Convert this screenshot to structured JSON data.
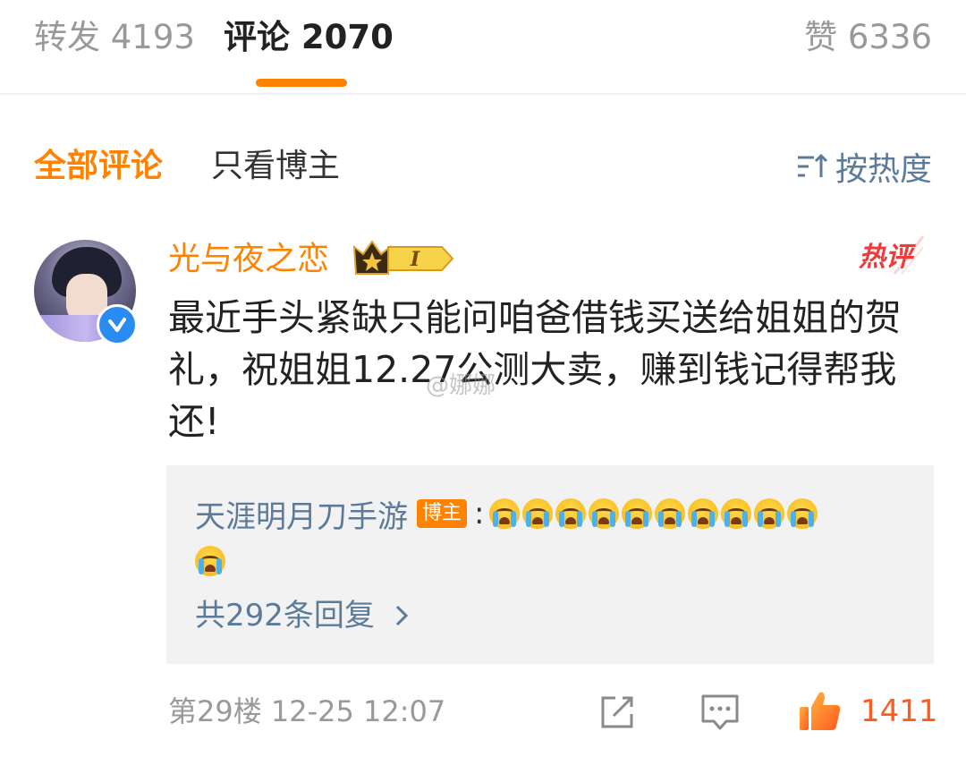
{
  "tabs": {
    "repost_label": "转发 4193",
    "comment_label": "评论 2070",
    "like_label": "赞 6336"
  },
  "filters": {
    "all_label": "全部评论",
    "owner_only_label": "只看博主",
    "sort_label": "按热度",
    "sort_icon": "sort-icon"
  },
  "comment": {
    "username": "光与夜之恋",
    "badge_level": "I",
    "hot_label": "热评",
    "text": "最近手头紧缺只能问咱爸借钱买送给姐姐的贺礼，祝姐姐12.27公测大卖，赚到钱记得帮我还!",
    "watermark": "@娜娜",
    "floor_time": "第29楼 12-25 12:07",
    "like_count": "1411"
  },
  "reply": {
    "username": "天涯明月刀手游",
    "owner_tag": "博主",
    "colon": ":",
    "emoji_name": "crying-face-icon",
    "emoji_count": 11,
    "count_label": "共292条回复"
  },
  "colors": {
    "accent": "#ff8200",
    "link": "#5c7a99",
    "like": "#ff5a1f",
    "verified": "#2a8bf2"
  }
}
